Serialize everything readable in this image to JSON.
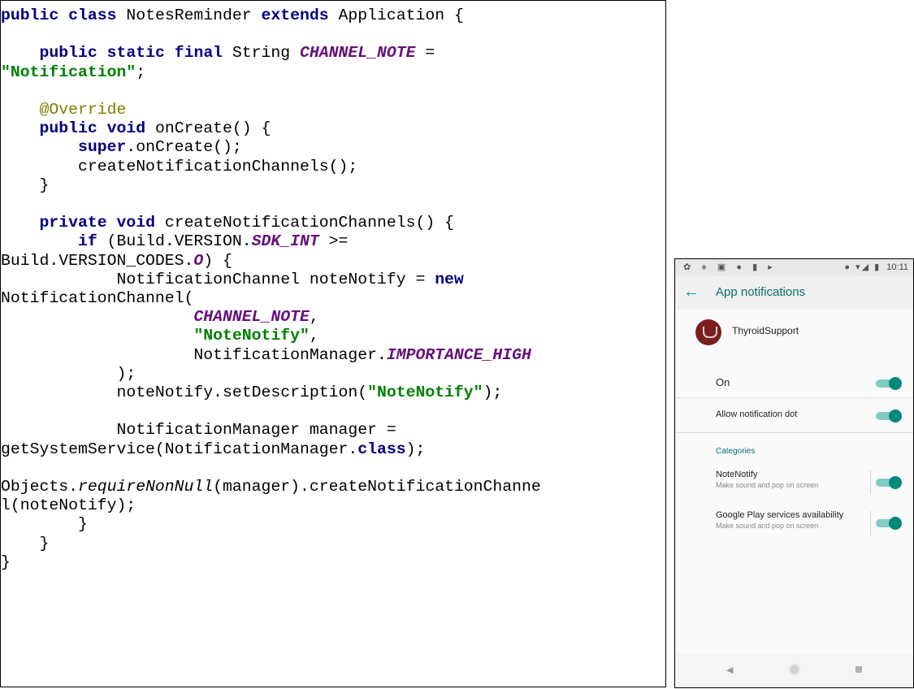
{
  "code": {
    "lines": [
      [
        {
          "t": "public",
          "c": "kw"
        },
        {
          "t": " "
        },
        {
          "t": "class",
          "c": "kw"
        },
        {
          "t": " NotesReminder "
        },
        {
          "t": "extends",
          "c": "kw"
        },
        {
          "t": " Application {"
        }
      ],
      [],
      [
        {
          "t": "    "
        },
        {
          "t": "public",
          "c": "kw"
        },
        {
          "t": " "
        },
        {
          "t": "static",
          "c": "kw"
        },
        {
          "t": " "
        },
        {
          "t": "final",
          "c": "kw"
        },
        {
          "t": " String "
        },
        {
          "t": "CHANNEL_NOTE",
          "c": "fld"
        },
        {
          "t": " ="
        }
      ],
      [
        {
          "t": "\"Notification\"",
          "c": "str"
        },
        {
          "t": ";"
        }
      ],
      [],
      [
        {
          "t": "    "
        },
        {
          "t": "@Override",
          "c": "ann"
        }
      ],
      [
        {
          "t": "    "
        },
        {
          "t": "public",
          "c": "kw"
        },
        {
          "t": " "
        },
        {
          "t": "void",
          "c": "kw"
        },
        {
          "t": " onCreate() {"
        }
      ],
      [
        {
          "t": "        "
        },
        {
          "t": "super",
          "c": "kw"
        },
        {
          "t": ".onCreate();"
        }
      ],
      [
        {
          "t": "        createNotificationChannels();"
        }
      ],
      [
        {
          "t": "    }"
        }
      ],
      [],
      [
        {
          "t": "    "
        },
        {
          "t": "private",
          "c": "kw"
        },
        {
          "t": " "
        },
        {
          "t": "void",
          "c": "kw"
        },
        {
          "t": " createNotificationChannels() {"
        }
      ],
      [
        {
          "t": "        "
        },
        {
          "t": "if",
          "c": "kw"
        },
        {
          "t": " (Build.VERSION."
        },
        {
          "t": "SDK_INT",
          "c": "fld"
        },
        {
          "t": " >="
        }
      ],
      [
        {
          "t": "Build.VERSION_CODES."
        },
        {
          "t": "O",
          "c": "fld"
        },
        {
          "t": ") {"
        }
      ],
      [
        {
          "t": "            NotificationChannel noteNotify = "
        },
        {
          "t": "new",
          "c": "kw"
        }
      ],
      [
        {
          "t": "NotificationChannel("
        }
      ],
      [
        {
          "t": "                    "
        },
        {
          "t": "CHANNEL_NOTE",
          "c": "fld"
        },
        {
          "t": ","
        }
      ],
      [
        {
          "t": "                    "
        },
        {
          "t": "\"NoteNotify\"",
          "c": "str"
        },
        {
          "t": ","
        }
      ],
      [
        {
          "t": "                    NotificationManager."
        },
        {
          "t": "IMPORTANCE_HIGH",
          "c": "fld"
        }
      ],
      [
        {
          "t": "            );"
        }
      ],
      [
        {
          "t": "            noteNotify.setDescription("
        },
        {
          "t": "\"NoteNotify\"",
          "c": "str"
        },
        {
          "t": ");"
        }
      ],
      [],
      [
        {
          "t": "            NotificationManager manager ="
        }
      ],
      [
        {
          "t": "getSystemService(NotificationManager."
        },
        {
          "t": "class",
          "c": "kw"
        },
        {
          "t": ");"
        }
      ],
      [],
      [
        {
          "t": "Objects."
        },
        {
          "t": "requireNonNull",
          "c": "ital"
        },
        {
          "t": "(manager).createNotificationChanne"
        }
      ],
      [
        {
          "t": "l(noteNotify);"
        }
      ],
      [
        {
          "t": "        }"
        }
      ],
      [
        {
          "t": "    }"
        }
      ],
      [
        {
          "t": "}"
        }
      ]
    ]
  },
  "phone": {
    "status_left_icons": "✿ ⚹ ▣ ● ▮ ▸",
    "status_right_icons": "● ▾◢ ▮",
    "time": "10:11",
    "toolbar_title": "App notifications",
    "app_name": "ThyroidSupport",
    "on_label": "On",
    "on_value": true,
    "dot_label": "Allow notification dot",
    "dot_value": true,
    "categories_label": "Categories",
    "categories": [
      {
        "title": "NoteNotify",
        "subtitle": "Make sound and pop on screen",
        "enabled": true
      },
      {
        "title": "Google Play services availability",
        "subtitle": "Make sound and pop on screen",
        "enabled": true
      }
    ],
    "accent_color": "#00897b"
  }
}
